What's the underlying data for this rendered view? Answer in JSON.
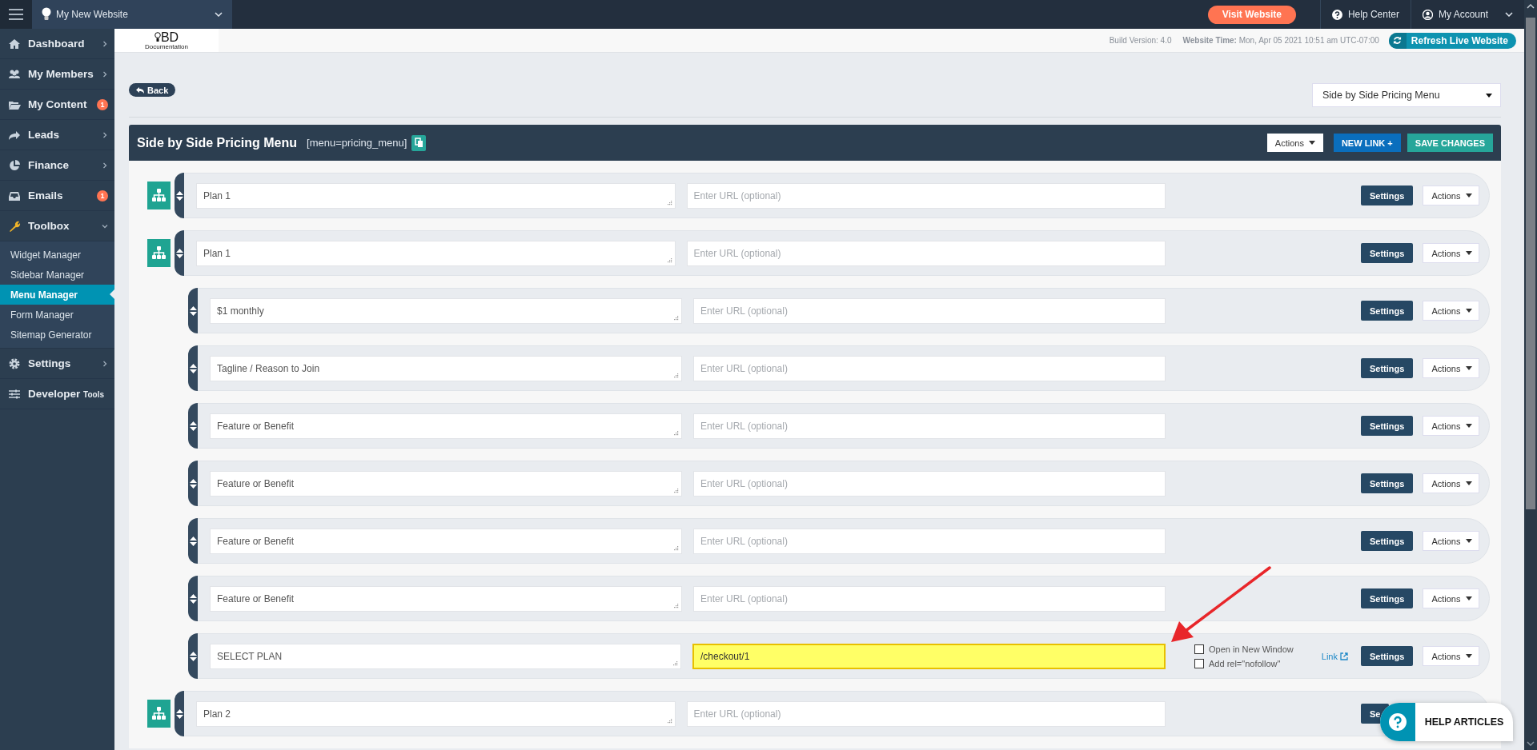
{
  "topbar": {
    "website": "My New Website",
    "visit_button": "Visit Website",
    "help": "Help Center",
    "account": "My Account"
  },
  "sidebar": {
    "items": [
      {
        "label": "Dashboard",
        "expanded": false
      },
      {
        "label": "My Members",
        "expanded": false
      },
      {
        "label": "My Content",
        "badge": "1"
      },
      {
        "label": "Leads",
        "expanded": false
      },
      {
        "label": "Finance",
        "expanded": false
      },
      {
        "label": "Emails",
        "badge": "1"
      },
      {
        "label": "Toolbox",
        "expanded": true,
        "children": [
          {
            "label": "Widget Manager",
            "selected": false
          },
          {
            "label": "Sidebar Manager",
            "selected": false
          },
          {
            "label": "Menu Manager",
            "selected": true
          },
          {
            "label": "Form Manager",
            "selected": false
          },
          {
            "label": "Sitemap Generator",
            "selected": false
          }
        ]
      },
      {
        "label": "Settings",
        "expanded": false
      },
      {
        "label": "Developer",
        "label_small": "Tools"
      }
    ]
  },
  "header": {
    "logo": "BD",
    "logo_subtext": "Documentation",
    "build": "Build Version: 4.0",
    "time": "**Website Time:** Mon, Apr 05 2021 10:51 am UTC-07:00",
    "refresh_button": "Refresh Live Website"
  },
  "toolbar": {
    "back_button": "Back",
    "menu_select": "Side by Side Pricing Menu"
  },
  "panel": {
    "title": "Side by Side Pricing Menu",
    "shortcode": "[menu=pricing_menu]",
    "actions": "Actions",
    "new_link": "NEW LINK +",
    "save": "SAVE CHANGES",
    "items": [
      {
        "title": "Plan 1",
        "url_placeholder": "Enter URL (optional)",
        "highlighted": false,
        "settings": "Settings",
        "actions": "Actions"
      },
      {
        "title": "Plan 1",
        "url_placeholder": "Enter URL (optional)",
        "highlighted": false,
        "settings": "Settings",
        "actions": "Actions",
        "children": [
          {
            "title": "$1 monthly",
            "url_placeholder": "Enter URL (optional)",
            "highlighted": false,
            "settings": "Settings",
            "actions": "Actions"
          },
          {
            "title": "Tagline / Reason to Join",
            "url_placeholder": "Enter URL (optional)",
            "highlighted": false,
            "settings": "Settings",
            "actions": "Actions"
          },
          {
            "title": "Feature or Benefit",
            "url_placeholder": "Enter URL (optional)",
            "highlighted": false,
            "settings": "Settings",
            "actions": "Actions"
          },
          {
            "title": "Feature or Benefit",
            "url_placeholder": "Enter URL (optional)",
            "highlighted": false,
            "settings": "Settings",
            "actions": "Actions"
          },
          {
            "title": "Feature or Benefit",
            "url_placeholder": "Enter URL (optional)",
            "highlighted": false,
            "settings": "Settings",
            "actions": "Actions"
          },
          {
            "title": "Feature or Benefit",
            "url_placeholder": "Enter URL (optional)",
            "highlighted": false,
            "settings": "Settings",
            "actions": "Actions"
          },
          {
            "title": "SELECT PLAN",
            "url": "/checkout/1",
            "highlighted": true,
            "options": [
              {
                "label": "Open in New Window",
                "checked": false
              },
              {
                "label": "Add rel=\"nofollow\"",
                "checked": false
              }
            ],
            "link": "Link",
            "settings": "Settings",
            "actions": "Actions"
          }
        ]
      },
      {
        "title": "Plan 2",
        "url_placeholder": "Enter URL (optional)",
        "highlighted": false,
        "settings": "Se"
      }
    ]
  },
  "help_widget": {
    "label": "HELP ARTICLES"
  }
}
